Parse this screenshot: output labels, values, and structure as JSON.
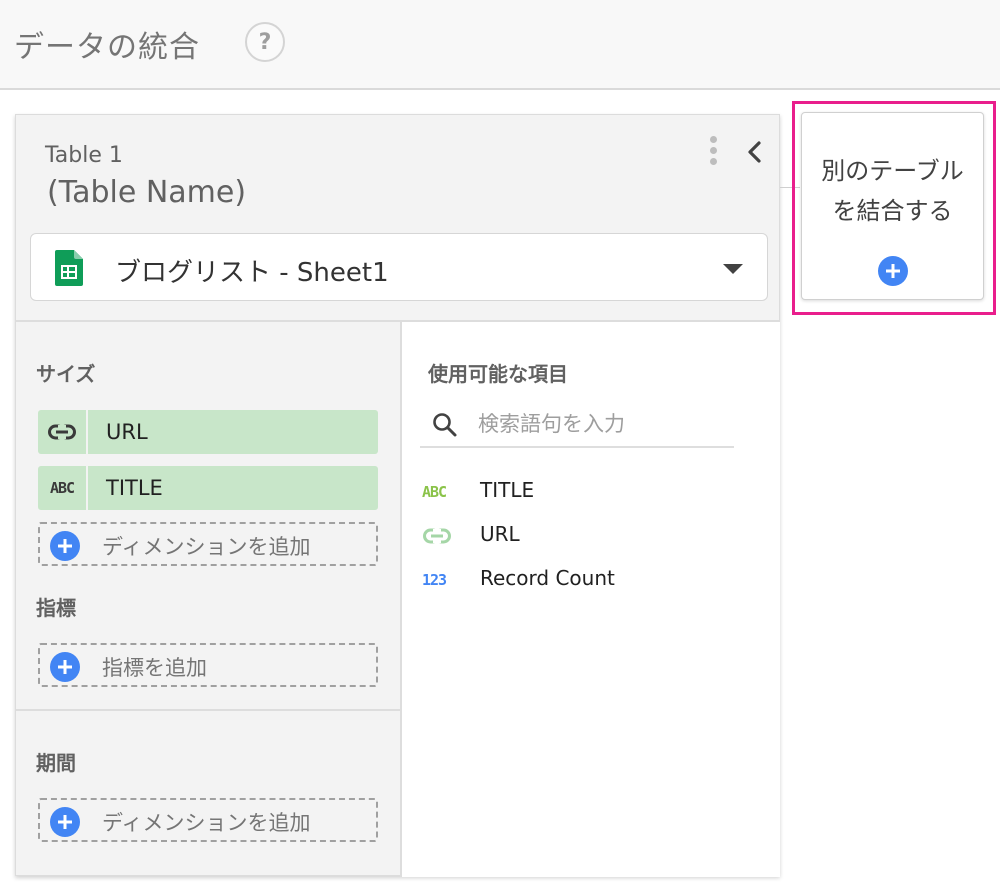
{
  "header": {
    "title": "データの統合",
    "help_label": "?"
  },
  "table_card": {
    "label": "Table 1",
    "name": "(Table Name)",
    "data_source": "ブログリスト - Sheet1",
    "dimensions": {
      "title": "サイズ",
      "items": [
        {
          "label": "URL",
          "icon": "link-icon"
        },
        {
          "label": "TITLE",
          "icon": "abc-text-icon",
          "icon_text": "ABC"
        }
      ],
      "add_label": "ディメンションを追加"
    },
    "metrics": {
      "title": "指標",
      "add_label": "指標を追加"
    },
    "date_range": {
      "title": "期間",
      "add_label": "ディメンションを追加"
    },
    "available_fields": {
      "title": "使用可能な項目",
      "search_placeholder": "検索語句を入力",
      "items": [
        {
          "label": "TITLE",
          "icon": "abc-text-icon",
          "icon_text": "ABC"
        },
        {
          "label": "URL",
          "icon": "link-icon"
        },
        {
          "label": "Record Count",
          "icon": "number-icon",
          "icon_text": "123"
        }
      ]
    }
  },
  "join_card": {
    "line1": "別のテーブル",
    "line2": "を結合する"
  },
  "colors": {
    "accent_blue": "#4285f4",
    "dimension_chip": "#c8e6c9",
    "highlight": "#e91e8c",
    "sheets_green": "#0f9d58"
  }
}
